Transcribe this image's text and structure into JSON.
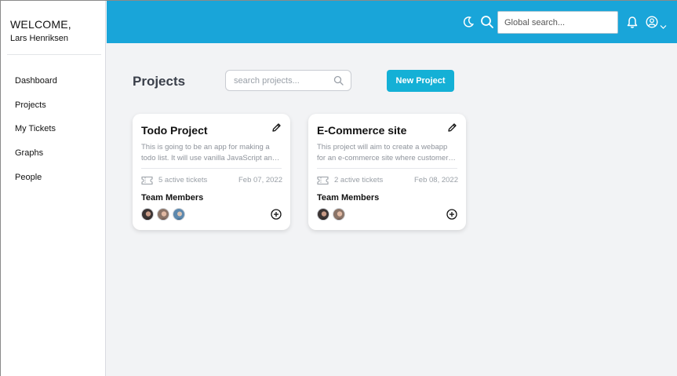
{
  "sidebar": {
    "welcome": "WELCOME,",
    "username": "Lars Henriksen",
    "items": [
      {
        "label": "Dashboard"
      },
      {
        "label": "Projects"
      },
      {
        "label": "My Tickets"
      },
      {
        "label": "Graphs"
      },
      {
        "label": "People"
      }
    ]
  },
  "topbar": {
    "color": "#19a5d9",
    "icons": [
      "moon-icon",
      "search-icon",
      "bell-icon",
      "user-circle-icon",
      "chevron-down-icon"
    ],
    "search_placeholder": "Global search..."
  },
  "main": {
    "title": "Projects",
    "search_placeholder": "search projects...",
    "new_project_label": "New Project",
    "accent": "#14b0d6"
  },
  "projects": [
    {
      "title": "Todo Project",
      "description": "This is going to be an app for making a todo list. It will use vanilla JavaScript and local storage.",
      "tickets": "5 active tickets",
      "date": "Feb 07, 2022",
      "members_label": "Team Members",
      "member_count": 3
    },
    {
      "title": "E-Commerce site",
      "description": "This project will aim to create a webapp for an e-commerce site where customers can shop.",
      "tickets": "2 active tickets",
      "date": "Feb 08, 2022",
      "members_label": "Team Members",
      "member_count": 2
    }
  ]
}
